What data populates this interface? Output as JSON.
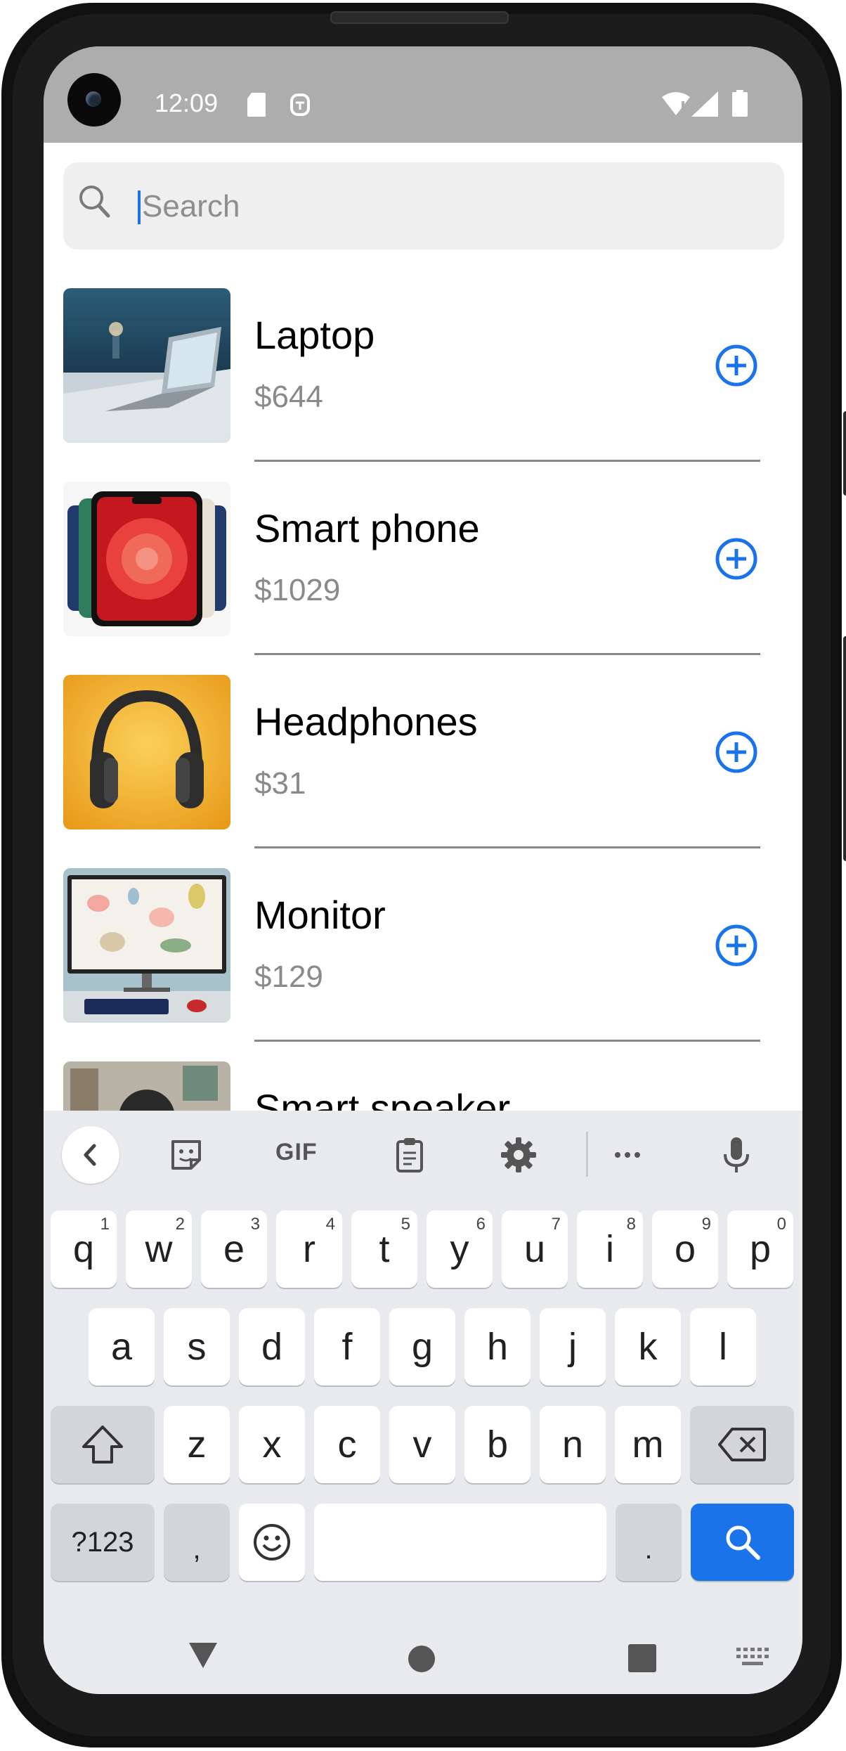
{
  "status_bar": {
    "time": "12:09",
    "icons": [
      "sd-card-icon",
      "accessibility-icon",
      "wifi-icon",
      "signal-icon",
      "battery-icon"
    ]
  },
  "search": {
    "placeholder": "Search",
    "value": ""
  },
  "products": [
    {
      "name": "Laptop",
      "price": "$644",
      "image": "laptop-photo",
      "action": "add-icon"
    },
    {
      "name": "Smart phone",
      "price": "$1029",
      "image": "smartphone-photo",
      "action": "add-icon"
    },
    {
      "name": "Headphones",
      "price": "$31",
      "image": "headphones-photo",
      "action": "add-icon"
    },
    {
      "name": "Monitor",
      "price": "$129",
      "image": "monitor-photo",
      "action": "add-icon"
    },
    {
      "name": "Smart speaker",
      "price": "",
      "image": "smart-speaker-photo",
      "action": "add-icon"
    }
  ],
  "keyboard": {
    "toolbar": {
      "gif_label": "GIF",
      "icons": [
        "chevron-left-icon",
        "sticker-icon",
        "clipboard-icon",
        "gear-icon",
        "more-icon",
        "mic-icon"
      ]
    },
    "row1": [
      {
        "k": "q",
        "h": "1"
      },
      {
        "k": "w",
        "h": "2"
      },
      {
        "k": "e",
        "h": "3"
      },
      {
        "k": "r",
        "h": "4"
      },
      {
        "k": "t",
        "h": "5"
      },
      {
        "k": "y",
        "h": "6"
      },
      {
        "k": "u",
        "h": "7"
      },
      {
        "k": "i",
        "h": "8"
      },
      {
        "k": "o",
        "h": "9"
      },
      {
        "k": "p",
        "h": "0"
      }
    ],
    "row2": [
      "a",
      "s",
      "d",
      "f",
      "g",
      "h",
      "j",
      "k",
      "l"
    ],
    "row3": [
      "z",
      "x",
      "c",
      "v",
      "b",
      "n",
      "m"
    ],
    "symbols_label": "?123",
    "comma_label": ",",
    "period_label": "."
  },
  "colors": {
    "accent": "#1a73e8",
    "status_bar": "#adadad",
    "keyboard_bg": "#e8eaed"
  }
}
